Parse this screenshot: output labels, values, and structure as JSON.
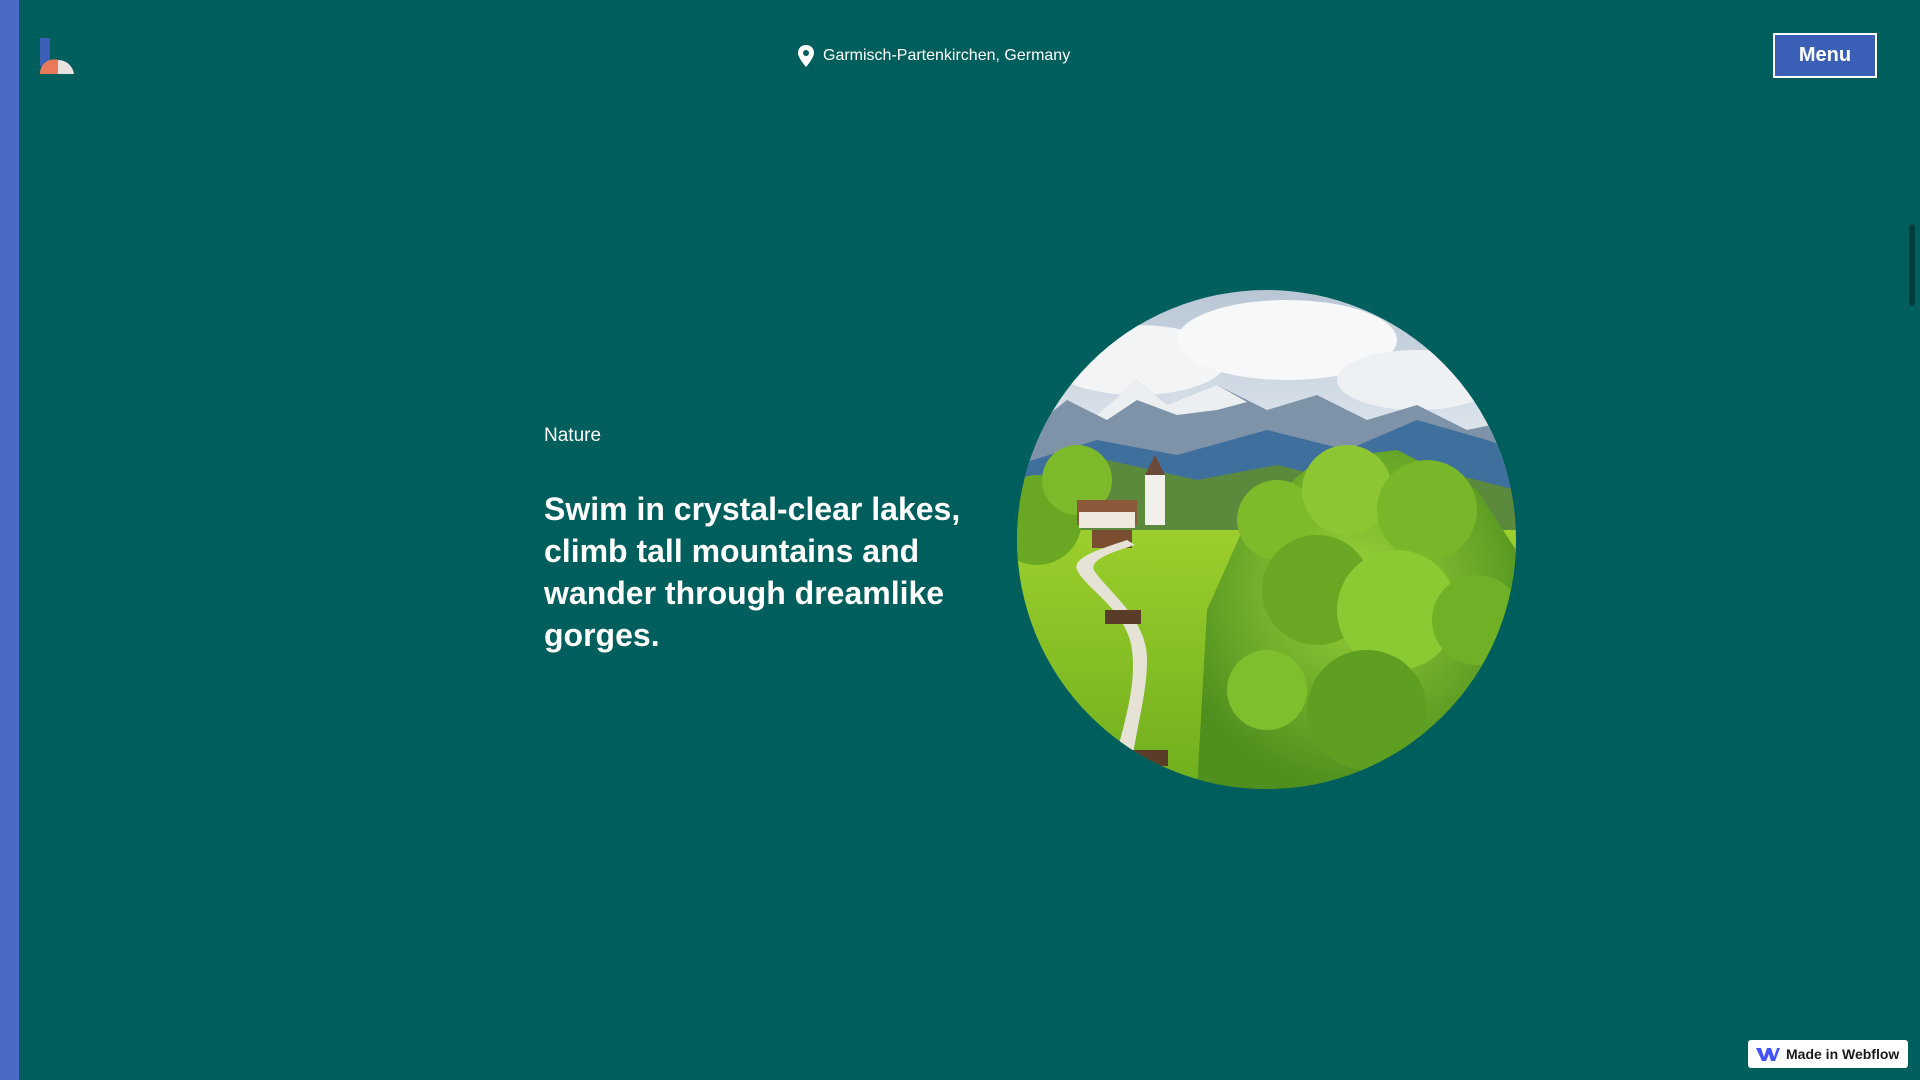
{
  "header": {
    "location": "Garmisch-Partenkirchen, Germany",
    "location_icon": "map-pin-icon",
    "menu_label": "Menu",
    "logo_icon": "brand-logo-icon"
  },
  "main": {
    "eyebrow": "Nature",
    "headline": "Swim in crystal-clear lakes, climb tall mountains and wander through dreamlike gorges.",
    "hero_image_alt": "hero-landscape-image"
  },
  "badge": {
    "label": "Made in Webflow",
    "icon": "webflow-icon"
  },
  "colors": {
    "background": "#005f5c",
    "accent_blue": "#3b5fb7",
    "side_strip": "#4a6bc4",
    "text": "#ffffff"
  }
}
